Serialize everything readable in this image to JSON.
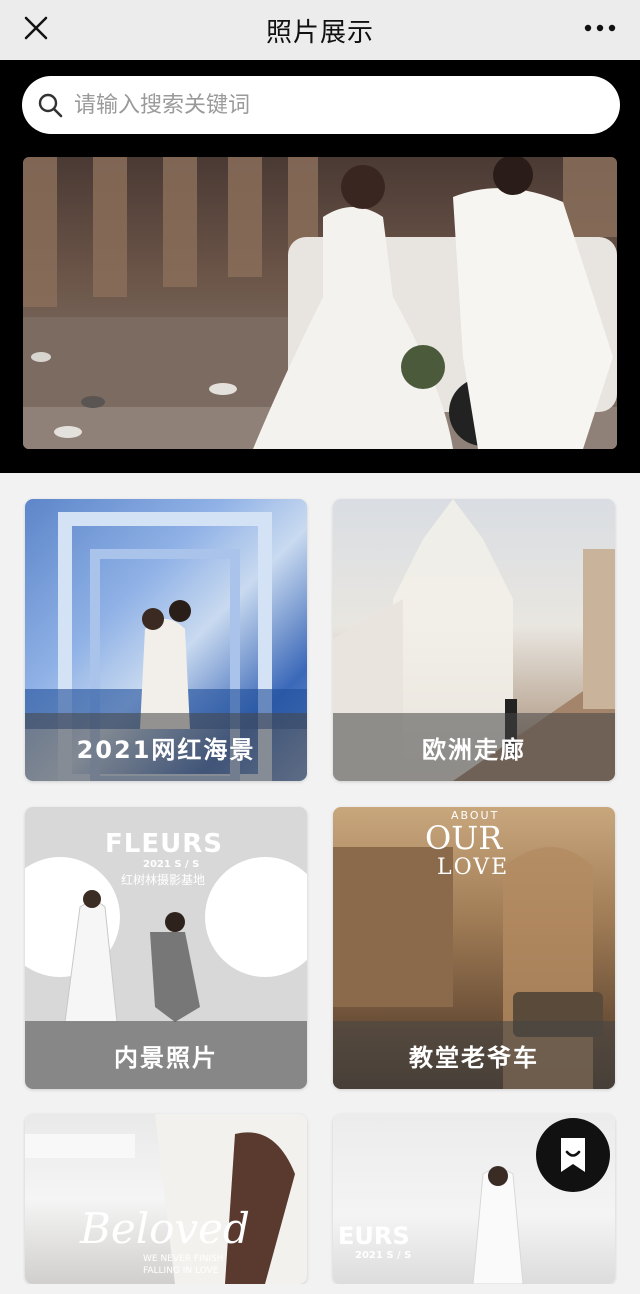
{
  "header": {
    "title": "照片展示",
    "close_icon": "close-icon",
    "more_icon": "more-icon"
  },
  "search": {
    "placeholder": "请输入搜索关键词",
    "value": "",
    "icon": "search-icon"
  },
  "hero": {
    "alt": "wedding couple banner photo"
  },
  "cards": [
    {
      "label": "2021网红海景"
    },
    {
      "label": "欧洲走廊"
    },
    {
      "label": "内景照片",
      "overlay_title": "FLEURS",
      "overlay_sub": "2021 S / S",
      "overlay_sub2": "红树林摄影基地"
    },
    {
      "label": "教堂老爷车",
      "overlay_small": "ABOUT",
      "overlay_title": "OUR",
      "overlay_title2": "LOVE"
    },
    {
      "label": "",
      "overlay_title": "Beloved",
      "overlay_sub": "WE NEVER FINISH",
      "overlay_sub2": "FALLING IN LOVE"
    },
    {
      "label": "",
      "overlay_title": "EURS",
      "overlay_sub": "2021 S / S"
    }
  ],
  "fab": {
    "icon": "bookmark-icon"
  },
  "colors": {
    "topbar_bg": "#ececec",
    "hero_band_bg": "#000000",
    "fab_bg": "#111111",
    "caption_bg": "rgba(70,70,70,0.55)"
  }
}
